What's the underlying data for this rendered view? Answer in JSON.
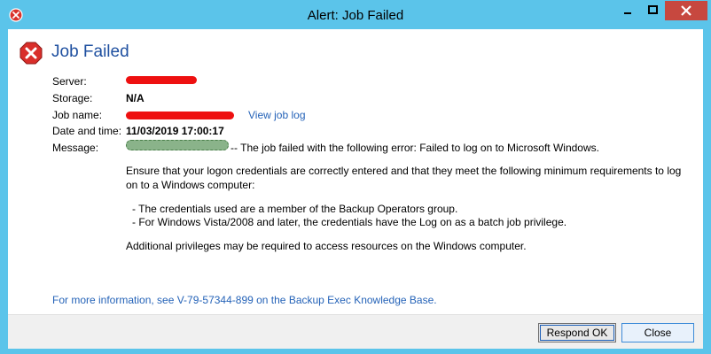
{
  "window": {
    "title": "Alert: Job Failed",
    "accent": "#5bc4ea",
    "close_color": "#c7483f"
  },
  "header": {
    "title": "Job Failed",
    "icon": "error-icon"
  },
  "details": {
    "server_label": "Server:",
    "storage_label": "Storage:",
    "storage_value": "N/A",
    "jobname_label": "Job name:",
    "view_log_link": "View job log",
    "datetime_label": "Date and time:",
    "datetime_value": "11/03/2019 17:00:17",
    "message_label": "Message:",
    "message_first_line": "-- The job failed with the following error: Failed to log on to Microsoft Windows."
  },
  "message": {
    "para1_line1": "Ensure that your logon credentials are correctly entered and that they meet the following minimum requirements to log",
    "para1_line2": "on to a Windows computer:",
    "bullet1": "- The credentials used are a member of the Backup Operators group.",
    "bullet2": "- For Windows Vista/2008 and later, the credentials have the Log on as a batch job privilege.",
    "para2": "Additional privileges may be required to access resources on the Windows computer."
  },
  "more_info": "For more information, see V-79-57344-899 on the Backup Exec Knowledge Base.",
  "buttons": {
    "respond_ok": "Respond OK",
    "close": "Close"
  }
}
